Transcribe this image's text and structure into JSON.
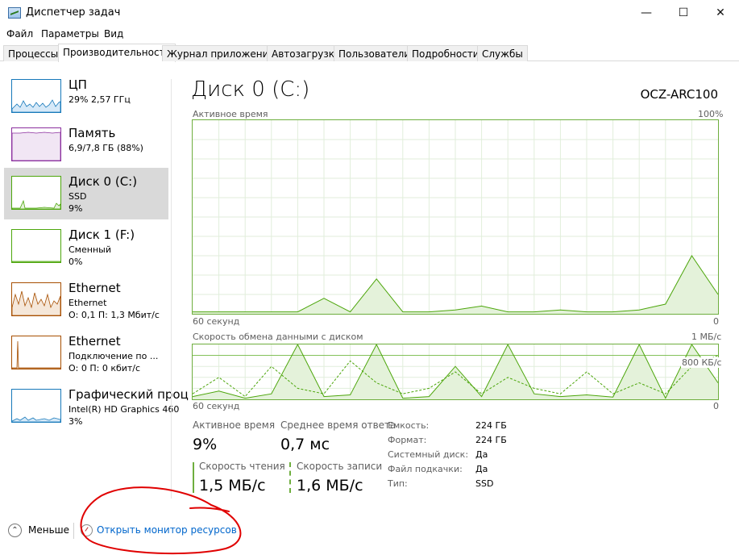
{
  "window": {
    "title": "Диспетчер задач",
    "min_icon": "minimize-icon",
    "max_icon": "maximize-icon",
    "close_icon": "close-icon"
  },
  "menu": [
    "Файл",
    "Параметры",
    "Вид"
  ],
  "tabs": [
    "Процессы",
    "Производительность",
    "Журнал приложений",
    "Автозагрузка",
    "Пользователи",
    "Подробности",
    "Службы"
  ],
  "active_tab": "Производительность",
  "sidebar": [
    {
      "title": "ЦП",
      "line1": "29% 2,57 ГГц",
      "line2": "",
      "color": "#1779ba",
      "fill": "#d6e9f8"
    },
    {
      "title": "Память",
      "line1": "6,9/7,8 ГБ (88%)",
      "line2": "",
      "color": "#8b2f9e",
      "fill": "#f1e6f4"
    },
    {
      "title": "Диск 0 (C:)",
      "line1": "SSD",
      "line2": "9%",
      "color": "#4da60c",
      "fill": "#e4f2da"
    },
    {
      "title": "Диск 1 (F:)",
      "line1": "Сменный",
      "line2": "0%",
      "color": "#4da60c",
      "fill": "#e4f2da"
    },
    {
      "title": "Ethernet",
      "line1": "Ethernet",
      "line2": "О: 0,1  П: 1,3 Мбит/с",
      "color": "#a74f01",
      "fill": "#f5e7d9"
    },
    {
      "title": "Ethernet",
      "line1": "Подключение по ...",
      "line2": "О: 0  П: 0 кбит/с",
      "color": "#a74f01",
      "fill": "#f5e7d9"
    },
    {
      "title": "Графический проц",
      "line1": "Intel(R) HD Graphics 460",
      "line2": "3%",
      "color": "#1779ba",
      "fill": "#d6e9f8"
    }
  ],
  "main": {
    "title": "Диск 0 (C:)",
    "model": "OCZ-ARC100",
    "chart1": {
      "label": "Активное время",
      "max_label": "100%",
      "time_label": "60 секунд",
      "min_label": "0"
    },
    "chart2": {
      "label": "Скорость обмена данными с диском",
      "max_label": "1 МБ/с",
      "mid_label": "800 КБ/с",
      "time_label": "60 секунд",
      "min_label": "0"
    },
    "stats": {
      "active_label": "Активное время",
      "active_value": "9%",
      "resp_label": "Среднее время ответа",
      "resp_value": "0,7 мс",
      "read_label": "Скорость чтения",
      "read_value": "1,5 МБ/с",
      "write_label": "Скорость записи",
      "write_value": "1,6 МБ/с"
    },
    "props": [
      {
        "k": "Емкость:",
        "v": "224 ГБ"
      },
      {
        "k": "Формат:",
        "v": "224 ГБ"
      },
      {
        "k": "Системный диск:",
        "v": "Да"
      },
      {
        "k": "Файл подкачки:",
        "v": "Да"
      },
      {
        "k": "Тип:",
        "v": "SSD"
      }
    ]
  },
  "footer": {
    "less": "Меньше",
    "monitor": "Открыть монитор ресурсов"
  },
  "chart_data": [
    {
      "type": "area",
      "title": "Активное время",
      "ylabel": "Активное время",
      "ylim": [
        0,
        100
      ],
      "x": [
        0,
        3,
        6,
        9,
        12,
        15,
        18,
        21,
        24,
        27,
        30,
        33,
        36,
        39,
        42,
        45,
        48,
        51,
        54,
        57,
        60
      ],
      "series": [
        {
          "values": [
            1,
            1,
            1,
            1,
            1,
            8,
            1,
            18,
            1,
            1,
            2,
            4,
            1,
            1,
            2,
            1,
            1,
            2,
            5,
            30,
            10
          ]
        }
      ]
    },
    {
      "type": "line",
      "title": "Скорость обмена данными с диском",
      "ylabel": "Скорость обмена данными с диском",
      "ylim": [
        0,
        1
      ],
      "x": [
        0,
        3,
        6,
        9,
        12,
        15,
        18,
        21,
        24,
        27,
        30,
        33,
        36,
        39,
        42,
        45,
        48,
        51,
        54,
        57,
        60
      ],
      "series": [
        {
          "values": [
            0.05,
            0.15,
            0.02,
            0.1,
            1.0,
            0.05,
            0.08,
            1.0,
            0.02,
            0.05,
            0.6,
            0.05,
            1.0,
            0.1,
            0.05,
            0.08,
            0.04,
            1.0,
            0.02,
            1.0,
            0.3
          ]
        },
        {
          "values": [
            0.1,
            0.4,
            0.05,
            0.6,
            0.2,
            0.1,
            0.7,
            0.3,
            0.1,
            0.2,
            0.5,
            0.1,
            0.4,
            0.2,
            0.1,
            0.5,
            0.1,
            0.3,
            0.1,
            0.6,
            0.8
          ]
        }
      ]
    }
  ]
}
